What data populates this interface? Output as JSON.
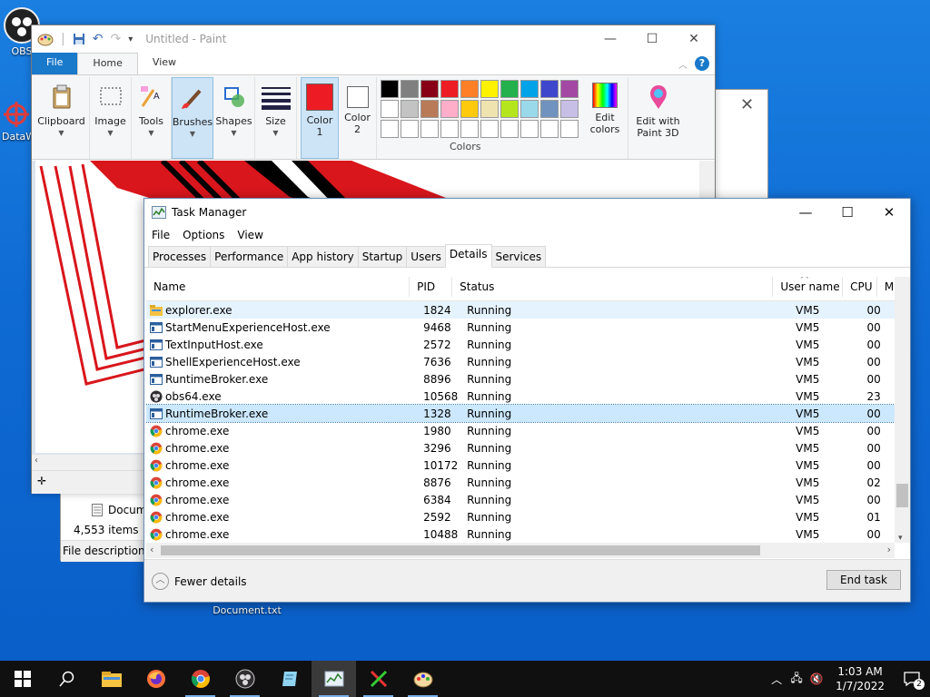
{
  "desktop": {
    "icons": [
      {
        "label": "OBS",
        "icon": "obs-icon"
      },
      {
        "label": "DataW",
        "icon": "app-icon"
      },
      {
        "label": "Document.txt",
        "icon": "text-document-icon"
      }
    ]
  },
  "explorer": {
    "row_label": "Docum",
    "item_count": "4,553 items",
    "status_text": "File description: A"
  },
  "paint": {
    "title": "Untitled - Paint",
    "tabs": [
      "File",
      "Home",
      "View"
    ],
    "groups": {
      "clipboard": "Clipboard",
      "image": "Image",
      "tools": "Tools",
      "brushes": "Brushes",
      "shapes": "Shapes",
      "size": "Size",
      "color1": "Color 1",
      "color2": "Color 2",
      "edit_colors": "Edit colors",
      "paint3d": "Edit with Paint 3D",
      "colors_label": "Colors"
    },
    "color1_value": "#ed1c24",
    "color2_value": "#ffffff",
    "palette": [
      "#000000",
      "#7f7f7f",
      "#880015",
      "#ed1c24",
      "#ff7f27",
      "#fff200",
      "#22b14c",
      "#00a2e8",
      "#3f48cc",
      "#a349a4",
      "#ffffff",
      "#c3c3c3",
      "#b97a57",
      "#ffaec9",
      "#ffc90e",
      "#efe4b0",
      "#b5e61d",
      "#99d9ea",
      "#7092be",
      "#c8bfe7",
      "#ffffff",
      "#ffffff",
      "#ffffff",
      "#ffffff",
      "#ffffff",
      "#ffffff",
      "#ffffff",
      "#ffffff",
      "#ffffff",
      "#ffffff"
    ]
  },
  "taskmanager": {
    "title": "Task Manager",
    "menu": [
      "File",
      "Options",
      "View"
    ],
    "tabs": [
      "Processes",
      "Performance",
      "App history",
      "Startup",
      "Users",
      "Details",
      "Services"
    ],
    "active_tab": "Details",
    "columns": {
      "name": "Name",
      "pid": "PID",
      "status": "Status",
      "user": "User name",
      "cpu": "CPU",
      "mem": "M"
    },
    "rows": [
      {
        "name": "explorer.exe",
        "pid": "1824",
        "status": "Running",
        "user": "VM5",
        "cpu": "00",
        "icon": "folder"
      },
      {
        "name": "StartMenuExperienceHost.exe",
        "pid": "9468",
        "status": "Running",
        "user": "VM5",
        "cpu": "00",
        "icon": "window"
      },
      {
        "name": "TextInputHost.exe",
        "pid": "2572",
        "status": "Running",
        "user": "VM5",
        "cpu": "00",
        "icon": "window"
      },
      {
        "name": "ShellExperienceHost.exe",
        "pid": "7636",
        "status": "Running",
        "user": "VM5",
        "cpu": "00",
        "icon": "window"
      },
      {
        "name": "RuntimeBroker.exe",
        "pid": "8896",
        "status": "Running",
        "user": "VM5",
        "cpu": "00",
        "icon": "window"
      },
      {
        "name": "obs64.exe",
        "pid": "10568",
        "status": "Running",
        "user": "VM5",
        "cpu": "23",
        "icon": "obs"
      },
      {
        "name": "RuntimeBroker.exe",
        "pid": "1328",
        "status": "Running",
        "user": "VM5",
        "cpu": "00",
        "icon": "window"
      },
      {
        "name": "chrome.exe",
        "pid": "1980",
        "status": "Running",
        "user": "VM5",
        "cpu": "00",
        "icon": "chrome"
      },
      {
        "name": "chrome.exe",
        "pid": "3296",
        "status": "Running",
        "user": "VM5",
        "cpu": "00",
        "icon": "chrome"
      },
      {
        "name": "chrome.exe",
        "pid": "10172",
        "status": "Running",
        "user": "VM5",
        "cpu": "00",
        "icon": "chrome"
      },
      {
        "name": "chrome.exe",
        "pid": "8876",
        "status": "Running",
        "user": "VM5",
        "cpu": "02",
        "icon": "chrome"
      },
      {
        "name": "chrome.exe",
        "pid": "6384",
        "status": "Running",
        "user": "VM5",
        "cpu": "00",
        "icon": "chrome"
      },
      {
        "name": "chrome.exe",
        "pid": "2592",
        "status": "Running",
        "user": "VM5",
        "cpu": "01",
        "icon": "chrome"
      },
      {
        "name": "chrome.exe",
        "pid": "10488",
        "status": "Running",
        "user": "VM5",
        "cpu": "00",
        "icon": "chrome"
      }
    ],
    "selected_row": 6,
    "hover_row": 0,
    "fewer_details": "Fewer details",
    "end_task": "End task"
  },
  "taskbar": {
    "apps": [
      "start-icon",
      "search-icon",
      "file-explorer-icon",
      "firefox-icon",
      "chrome-icon",
      "obs-icon",
      "notepad-icon",
      "task-manager-icon",
      "app-icon",
      "paint-icon"
    ],
    "time": "1:03 AM",
    "date": "1/7/2022",
    "notification_count": "2"
  }
}
